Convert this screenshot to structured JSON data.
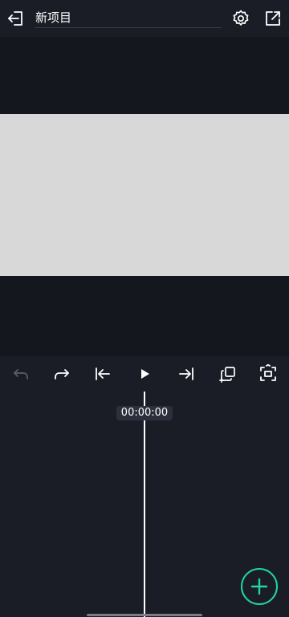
{
  "header": {
    "title": "新项目",
    "back_icon": "back-arrow-icon",
    "settings_icon": "gear-icon",
    "export_icon": "export-icon"
  },
  "controls": {
    "undo_icon": "undo-icon",
    "redo_icon": "redo-icon",
    "skip_start_icon": "skip-start-icon",
    "play_icon": "play-icon",
    "skip_end_icon": "skip-end-icon",
    "crop_icon": "crop-icon",
    "fullscreen_icon": "fullscreen-icon"
  },
  "timeline": {
    "timecode": "00:00:00"
  },
  "add_button": {
    "icon": "plus-icon"
  },
  "colors": {
    "background": "#1b1d26",
    "preview_background": "#15171e",
    "canvas": "#d8d8d8",
    "accent": "#1fd6a3",
    "disabled_icon": "#5b5e6a"
  }
}
